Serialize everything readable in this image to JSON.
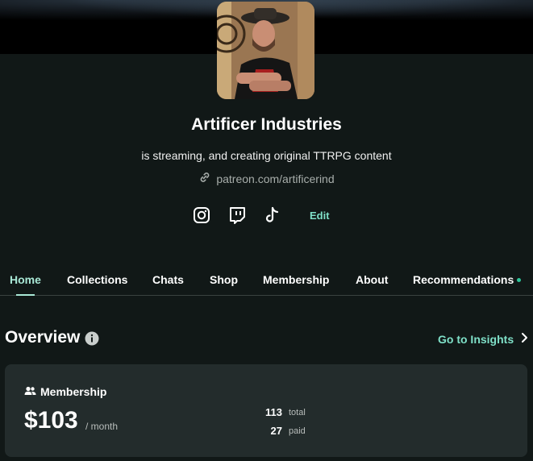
{
  "creator": {
    "name": "Artificer Industries",
    "tagline": "is streaming, and creating original TTRPG content",
    "link": "patreon.com/artificerind"
  },
  "social": {
    "icons": [
      "instagram-icon",
      "twitch-icon",
      "tiktok-icon"
    ],
    "edit_label": "Edit"
  },
  "tabs": [
    {
      "label": "Home",
      "active": true
    },
    {
      "label": "Collections",
      "active": false
    },
    {
      "label": "Chats",
      "active": false
    },
    {
      "label": "Shop",
      "active": false
    },
    {
      "label": "Membership",
      "active": false
    },
    {
      "label": "About",
      "active": false
    },
    {
      "label": "Recommendations",
      "active": false
    }
  ],
  "overview": {
    "title": "Overview",
    "insights_label": "Go to Insights"
  },
  "membership_card": {
    "label": "Membership",
    "amount": "$103",
    "period": "/ month",
    "total_count": "113",
    "total_label": "total",
    "paid_count": "27",
    "paid_label": "paid"
  },
  "colors": {
    "background": "#111817",
    "accent": "#7fe0c8",
    "active_tab": "#a9e8d6",
    "card": "#232c2c",
    "status_dot": "#2ec59a"
  }
}
